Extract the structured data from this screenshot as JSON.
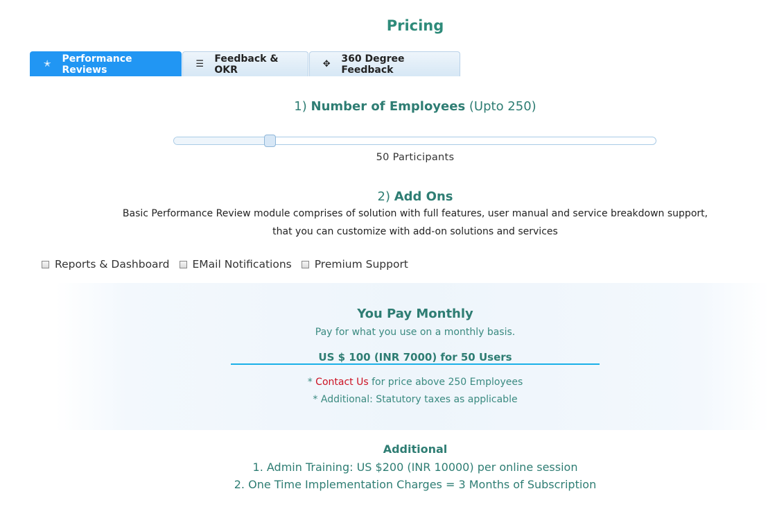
{
  "page_title": "Pricing",
  "tabs": [
    {
      "label": "Performance Reviews",
      "icon": "star-icon",
      "glyph": "✭",
      "active": true
    },
    {
      "label": "Feedback & OKR",
      "icon": "list-icon",
      "glyph": "☰",
      "active": false
    },
    {
      "label": "360 Degree Feedback",
      "icon": "crosshair-icon",
      "glyph": "✥",
      "active": false
    }
  ],
  "employees": {
    "prefix": "1) ",
    "heading": "Number of Employees",
    "suffix": " (Upto 250)",
    "slider_value": 50,
    "slider_max": 250,
    "value_label": "50 Participants"
  },
  "addons": {
    "prefix": "2) ",
    "heading": "Add Ons",
    "description_line1": "Basic Performance Review module comprises of solution with full features, user manual and service breakdown support,",
    "description_line2": "that you can customize with add-on solutions and services",
    "options": [
      {
        "label": "Reports & Dashboard",
        "checked": false
      },
      {
        "label": "EMail Notifications",
        "checked": false
      },
      {
        "label": "Premium Support",
        "checked": false
      }
    ]
  },
  "pricing": {
    "title": "You Pay Monthly",
    "subtitle": "Pay for what you use on a monthly basis.",
    "price": "US $ 100 (INR 7000) for 50 Users",
    "note1_prefix": "* ",
    "contact_link": "Contact Us",
    "note1_suffix": " for price above 250 Employees",
    "note2": "* Additional: Statutory taxes as applicable",
    "accent_color": "#1ab0e8",
    "link_color": "#cc1122"
  },
  "additional": {
    "title": "Additional",
    "items": [
      "1. Admin Training: US $200 (INR 10000) per online session",
      "2. One Time Implementation Charges = 3 Months of Subscription"
    ]
  },
  "colors": {
    "active_tab": "#2196f3",
    "heading_teal": "#2e7d73"
  }
}
